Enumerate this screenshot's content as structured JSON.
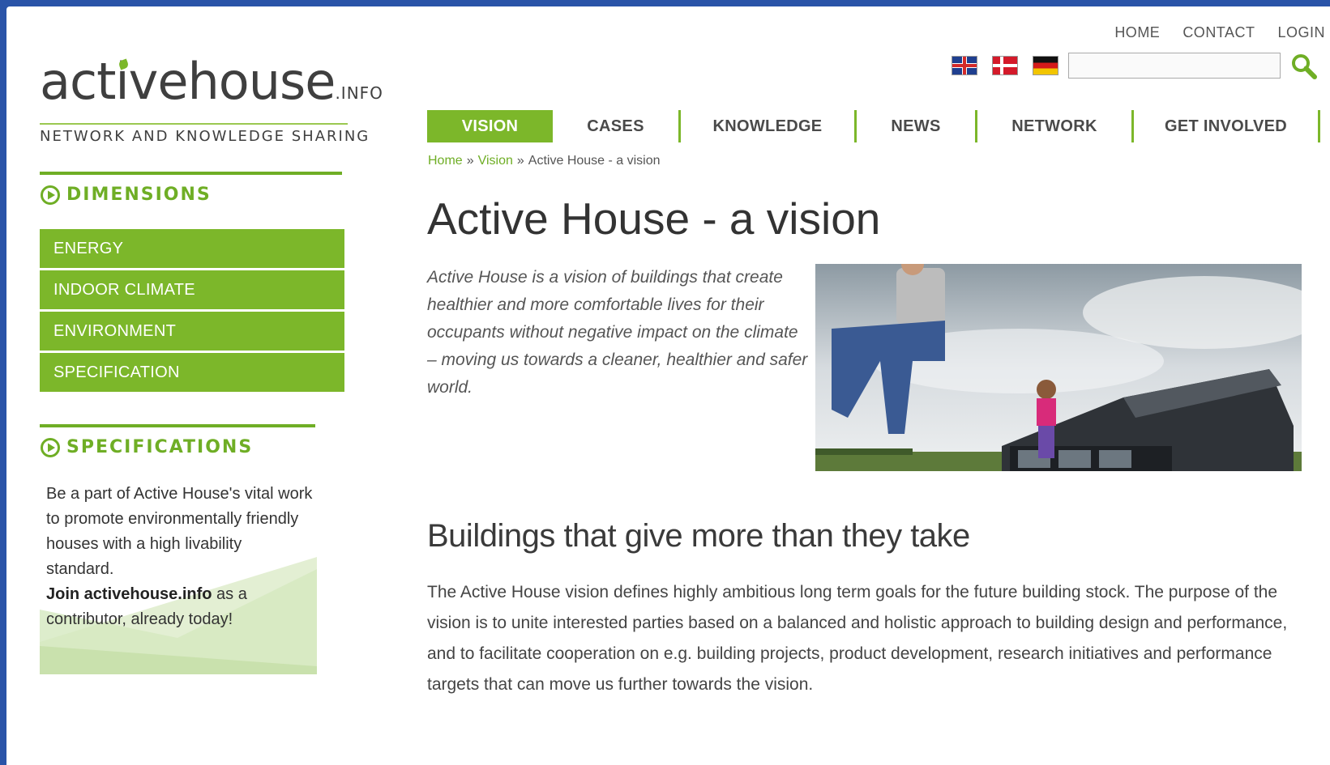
{
  "logo": {
    "main_a": "act",
    "main_i": "i",
    "main_b": "vehouse",
    "suffix": ".INFO",
    "tagline": "NETWORK AND KNOWLEDGE SHARING"
  },
  "toplinks": [
    "HOME",
    "CONTACT",
    "LOGIN"
  ],
  "search": {
    "value": "",
    "placeholder": ""
  },
  "nav": [
    "VISION",
    "CASES",
    "KNOWLEDGE",
    "NEWS",
    "NETWORK",
    "GET INVOLVED"
  ],
  "breadcrumb": {
    "home": "Home",
    "sep": "»",
    "vision": "Vision",
    "current": "Active House - a vision"
  },
  "page_title": "Active House - a vision",
  "intro": "Active House is a vision of buildings that create healthier and more comfortable lives for their occupants without negative impact on the climate – moving us towards a cleaner, healthier and safer world.",
  "section_heading": "Buildings that give more than they take",
  "body_text": "The Active House vision defines highly ambitious long term goals for the future building stock. The purpose of the vision is to unite interested parties based on a balanced and holistic approach to building design and performance, and to facilitate cooperation on e.g. building projects, product development, research initiatives and performance targets that can move us further towards the vision.",
  "sidebar": {
    "dimensions_title": "DIMENSIONS",
    "dimensions": [
      "ENERGY",
      "INDOOR CLIMATE",
      "ENVIRONMENT",
      "SPECIFICATION"
    ],
    "specifications_title": "SPECIFICATIONS",
    "spec_text": "Be a part of Active House's vital work to promote environmentally friendly houses with a high livability standard.",
    "spec_join_bold": "Join activehouse.info",
    "spec_join_rest": " as a contributor,  already today!"
  },
  "colors": {
    "accent": "#7cb72a",
    "frame": "#2a54a8"
  }
}
